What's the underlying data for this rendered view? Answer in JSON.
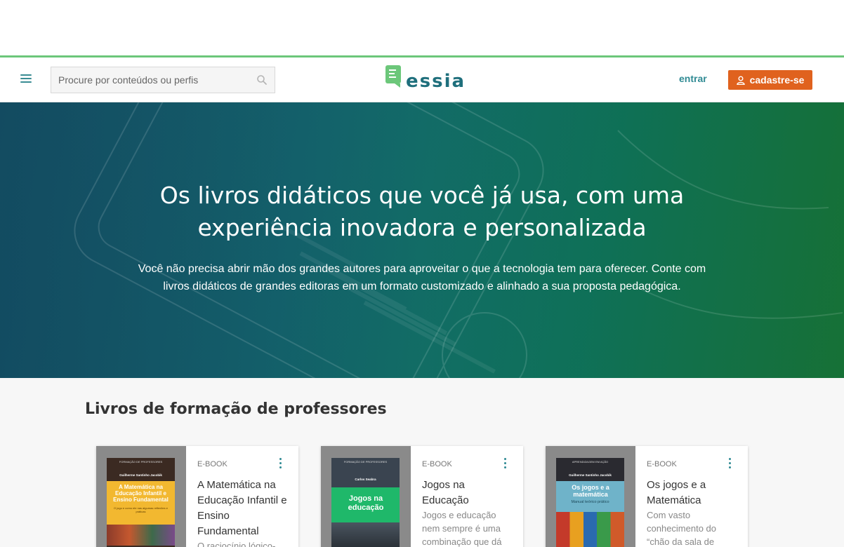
{
  "header": {
    "search": {
      "placeholder": "Procure por conteúdos ou perfis",
      "value": ""
    },
    "logo_text": "essia",
    "login_label": "entrar",
    "signup_label": "cadastre-se",
    "colors": {
      "accent_line": "#6cc77a",
      "brand_teal": "#1f6f7c",
      "signup_orange": "#e0621e"
    },
    "icons": [
      "menu-icon",
      "search-icon",
      "logo-icon",
      "user-icon"
    ]
  },
  "hero": {
    "title": "Os livros didáticos que você já usa, com uma experiência inovadora e personalizada",
    "subtitle": "Você não precisa abrir mão dos grandes autores para aproveitar o que a tecnologia tem para oferecer. Conte com livros didáticos de grandes editoras em um formato customizado e alinhado a sua proposta pedagógica."
  },
  "section": {
    "title": "Livros de formação de professores",
    "cards": [
      {
        "type": "E-BOOK",
        "title": "A Matemática na Educação Infantil e Ensino Fundamental",
        "description": "O raciocínio lógico-",
        "cover": {
          "series": "FORMAÇÃO DE PROFESSORES",
          "author": "Guilherme Santinho Jacobik",
          "title": "A Matemática na Educação Infantil e Ensino Fundamental",
          "subtitle": "O jogo e como ele nas algumas reflexões e práticas",
          "color": "#f2b830"
        }
      },
      {
        "type": "E-BOOK",
        "title": "Jogos na Educação",
        "description": "Jogos e educação nem sempre é uma combinação que dá",
        "cover": {
          "series": "FORMAÇÃO DE PROFESSORES",
          "author": "Carlos Seabra",
          "title": "Jogos na educação",
          "subtitle": "",
          "color": "#1fb86a"
        }
      },
      {
        "type": "E-BOOK",
        "title": "Os jogos e a Matemática",
        "description": "Com vasto conhecimento do “chão da sala de",
        "cover": {
          "series": "APRENDIZAGEM EM AÇÃO",
          "author": "Guilherme Santinho Jacobik",
          "title": "Os jogos e a matemática",
          "subtitle": "Manual teórico prático",
          "color": "#6fb3c9"
        }
      }
    ]
  }
}
